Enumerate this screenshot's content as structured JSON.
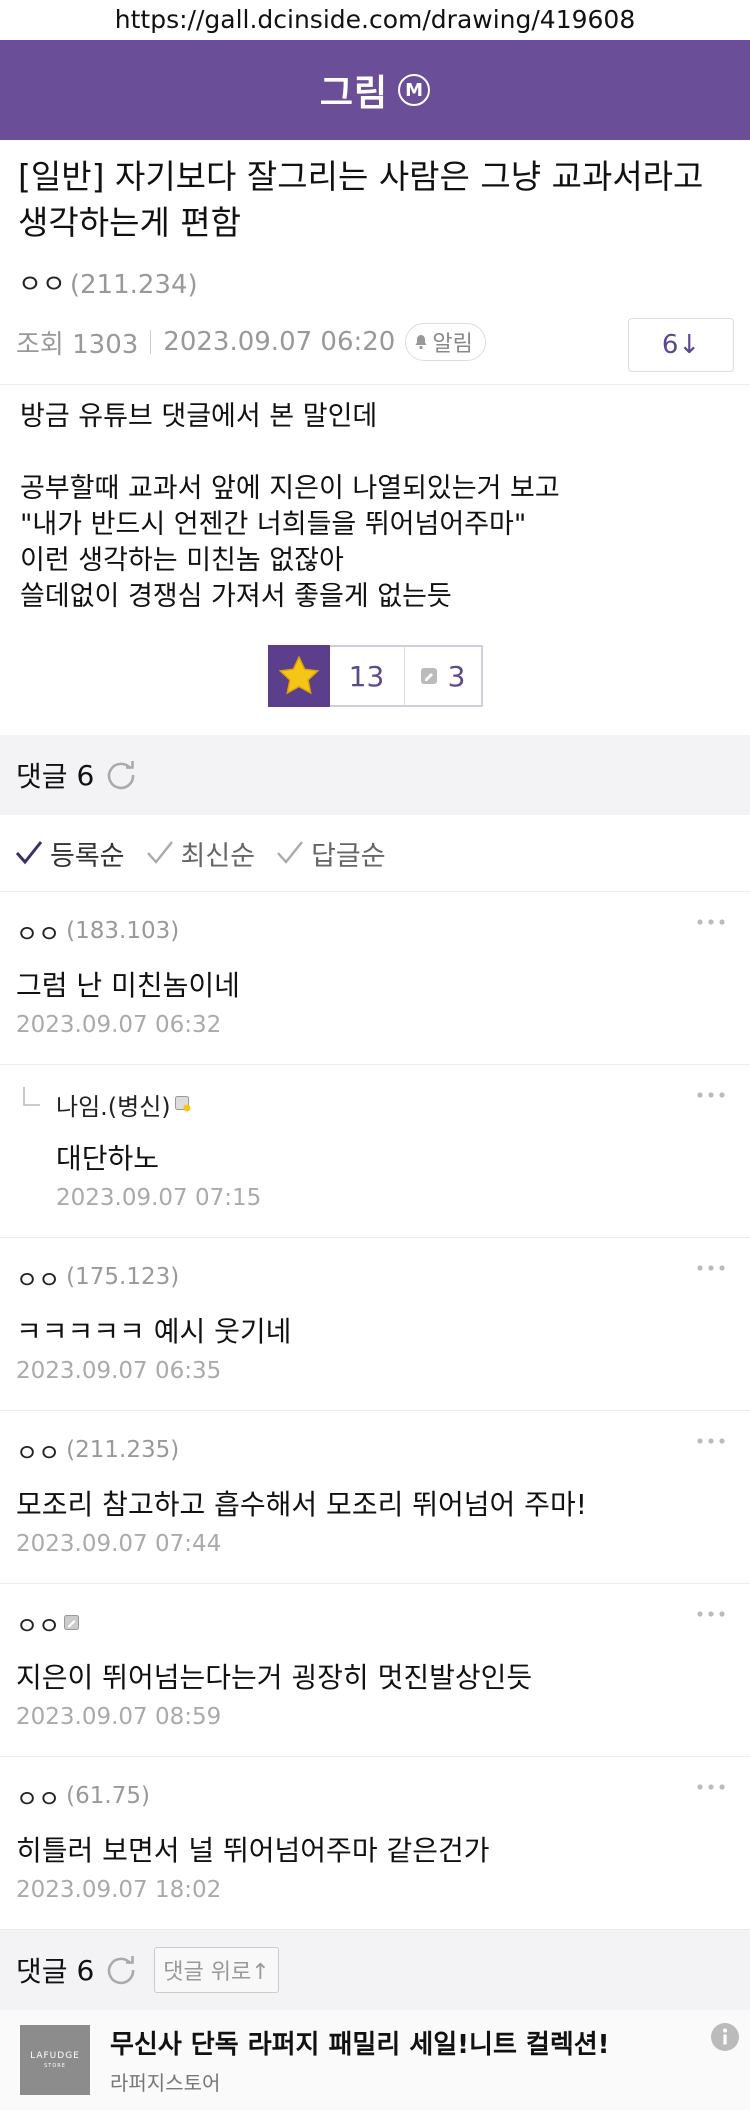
{
  "browser": {
    "url": "https://gall.dcinside.com/drawing/419608"
  },
  "gallery": {
    "title": "그림",
    "badge": "M"
  },
  "post": {
    "title": "[일반] 자기보다 잘그리는 사람은 그냥 교과서라고 생각하는게 편함",
    "author": "ㅇㅇ",
    "author_ip": "(211.234)",
    "views": "조회 1303",
    "date": "2023.09.07 06:20",
    "alarm_label": "알림",
    "comment_jump": "6↓",
    "body": [
      "방금 유튜브 댓글에서 본 말인데",
      "",
      "공부할때 교과서 앞에 지은이 나열되있는거 보고",
      "\"내가 반드시 언젠간 너희들을 뛰어넘어주마\"",
      "이런 생각하는 미친놈 없잖아",
      "쓸데없이 경쟁심 가져서 좋을게 없는듯"
    ],
    "recommend_count": "13",
    "fixed_recommend_count": "3"
  },
  "comments_header": {
    "label": "댓글",
    "count": "6"
  },
  "sort": {
    "register": "등록순",
    "latest": "최신순",
    "reply": "답글순"
  },
  "comments": [
    {
      "author": "ㅇㅇ",
      "ip": "(183.103)",
      "text": "그럼 난 미친놈이네",
      "date": "2023.09.07 06:32"
    },
    {
      "author": "나임.(병신)",
      "ip": "",
      "text": "대단하노",
      "date": "2023.09.07 07:15"
    },
    {
      "author": "ㅇㅇ",
      "ip": "(175.123)",
      "text": "ㅋㅋㅋㅋㅋ 예시 웃기네",
      "date": "2023.09.07 06:35"
    },
    {
      "author": "ㅇㅇ",
      "ip": "(211.235)",
      "text": "모조리 참고하고 흡수해서 모조리 뛰어넘어 주마!",
      "date": "2023.09.07 07:44"
    },
    {
      "author": "ㅇㅇ",
      "ip": "",
      "text": "지은이 뛰어넘는다는거 굉장히 멋진발상인듯",
      "date": "2023.09.07 08:59"
    },
    {
      "author": "ㅇㅇ",
      "ip": "(61.75)",
      "text": "히틀러 보면서 널 뛰어넘어주마 같은건가",
      "date": "2023.09.07 18:02"
    }
  ],
  "bottom_bar": {
    "label": "댓글",
    "count": "6",
    "up_button": "댓글 위로↑"
  },
  "ad": {
    "logo_text": "LAFUDGE",
    "logo_sub": "STORE",
    "title": "무신사 단독 라퍼지 패밀리 세일!니트 컬렉션!",
    "subtitle": "라퍼지스토어"
  },
  "colors": {
    "brand_purple": "#6a4f98",
    "star_bg": "#5b3f8c",
    "star_yellow": "#f5c518"
  }
}
